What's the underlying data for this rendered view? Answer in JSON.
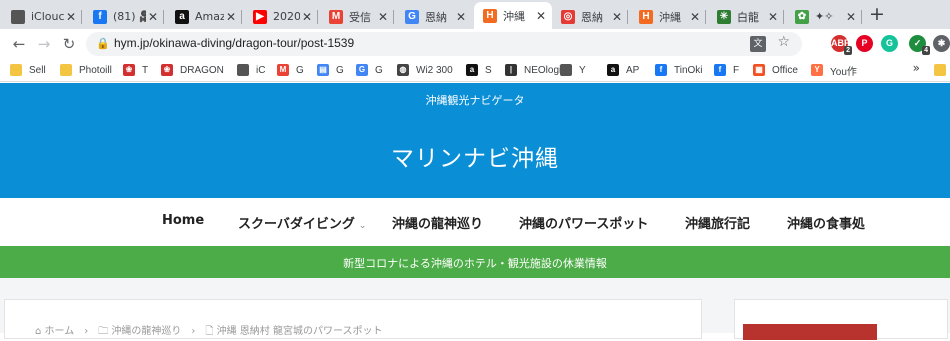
{
  "browser": {
    "tabs": [
      {
        "title": "iClouc",
        "icon": "apple-icon",
        "glyph": "",
        "color": "#555555"
      },
      {
        "title": "(81) 🎥",
        "icon": "facebook-icon",
        "glyph": "f",
        "color": "#1877f2"
      },
      {
        "title": "Amaz",
        "icon": "amazon-icon",
        "glyph": "a",
        "color": "#111111"
      },
      {
        "title": "2020",
        "icon": "youtube-icon",
        "glyph": "▶",
        "color": "#ff0000"
      },
      {
        "title": "受信",
        "icon": "gmail-icon",
        "glyph": "M",
        "color": "#ea4335"
      },
      {
        "title": "恩納",
        "icon": "google-icon",
        "glyph": "G",
        "color": "#4285f4"
      },
      {
        "title": "沖縄",
        "icon": "h-brand-icon",
        "glyph": "H",
        "color": "#f26b21"
      },
      {
        "title": "恩納",
        "icon": "target-icon",
        "glyph": "◎",
        "color": "#e53935"
      },
      {
        "title": "沖縄",
        "icon": "h-brand-icon",
        "glyph": "H",
        "color": "#f26b21"
      },
      {
        "title": "白龍",
        "icon": "dragon-icon",
        "glyph": "✳",
        "color": "#2e7d32"
      },
      {
        "title": "✦✧",
        "icon": "frog-icon",
        "glyph": "✿",
        "color": "#43a047"
      }
    ],
    "url": "hym.jp/okinawa-diving/dragon-tour/post-1539",
    "extensions": [
      {
        "name": "adblock-icon",
        "label": "ABP",
        "badge": "2",
        "color": "#d32f2f"
      },
      {
        "name": "pinterest-icon",
        "label": "P",
        "badge": "",
        "color": "#e60023"
      },
      {
        "name": "grammarly-icon",
        "label": "G",
        "badge": "",
        "color": "#15c39a"
      },
      {
        "name": "shield-ext-icon",
        "label": "✓",
        "badge": "4",
        "color": "#1e8e3e"
      },
      {
        "name": "puzzle-icon",
        "label": "✱",
        "badge": "",
        "color": "#5f6368"
      }
    ],
    "bookmarks": [
      {
        "label": "Sell",
        "icon": "folder-icon",
        "glyph": "",
        "color": "#f4c542"
      },
      {
        "label": "Photoill",
        "icon": "folder-icon",
        "glyph": "",
        "color": "#f4c542"
      },
      {
        "label": "T",
        "icon": "paw-icon",
        "glyph": "❀",
        "color": "#d32f2f"
      },
      {
        "label": "DRAGON",
        "icon": "paw-icon",
        "glyph": "❀",
        "color": "#d32f2f"
      },
      {
        "label": "iC",
        "icon": "apple-icon",
        "glyph": "",
        "color": "#555555"
      },
      {
        "label": "G",
        "icon": "gmail-icon",
        "glyph": "M",
        "color": "#ea4335"
      },
      {
        "label": "G",
        "icon": "docs-icon",
        "glyph": "▤",
        "color": "#4285f4"
      },
      {
        "label": "G",
        "icon": "google-icon",
        "glyph": "G",
        "color": "#4285f4"
      },
      {
        "label": "Wi2 300",
        "icon": "globe-icon",
        "glyph": "◍",
        "color": "#444444"
      },
      {
        "label": "S",
        "icon": "amazon-icon",
        "glyph": "a",
        "color": "#111111"
      },
      {
        "label": "NEOlogi",
        "icon": "bars-icon",
        "glyph": "|",
        "color": "#333333"
      },
      {
        "label": "Y",
        "icon": "apple-icon",
        "glyph": "",
        "color": "#555555"
      },
      {
        "label": "AP",
        "icon": "amazon-icon",
        "glyph": "a",
        "color": "#111111"
      },
      {
        "label": "TinOki",
        "icon": "facebook-icon",
        "glyph": "f",
        "color": "#1877f2"
      },
      {
        "label": "F",
        "icon": "facebook-icon",
        "glyph": "f",
        "color": "#1877f2"
      },
      {
        "label": "Office",
        "icon": "office-icon",
        "glyph": "▦",
        "color": "#f25022"
      },
      {
        "label": "You作",
        "icon": "y-icon",
        "glyph": "Y",
        "color": "#ff7043"
      }
    ]
  },
  "site": {
    "tagline": "沖縄観光ナビゲータ",
    "title": "マリンナビ沖縄",
    "header_color": "#0a8ed6",
    "nav": [
      {
        "label": "Home",
        "has_dropdown": false
      },
      {
        "label": "スクーバダイビング",
        "has_dropdown": true
      },
      {
        "label": "沖縄の龍神巡り",
        "has_dropdown": false
      },
      {
        "label": "沖縄のパワースポット",
        "has_dropdown": false
      },
      {
        "label": "沖縄旅行記",
        "has_dropdown": false
      },
      {
        "label": "沖縄の食事処",
        "has_dropdown": false
      }
    ],
    "notice": "新型コロナによる沖縄のホテル・観光施設の休業情報",
    "notice_color": "#4cac47",
    "breadcrumb": "⌂ ホーム　›　🗀 沖縄の龍神巡り　›　🗋 沖縄 恩納村 龍宮城のパワースポット"
  }
}
